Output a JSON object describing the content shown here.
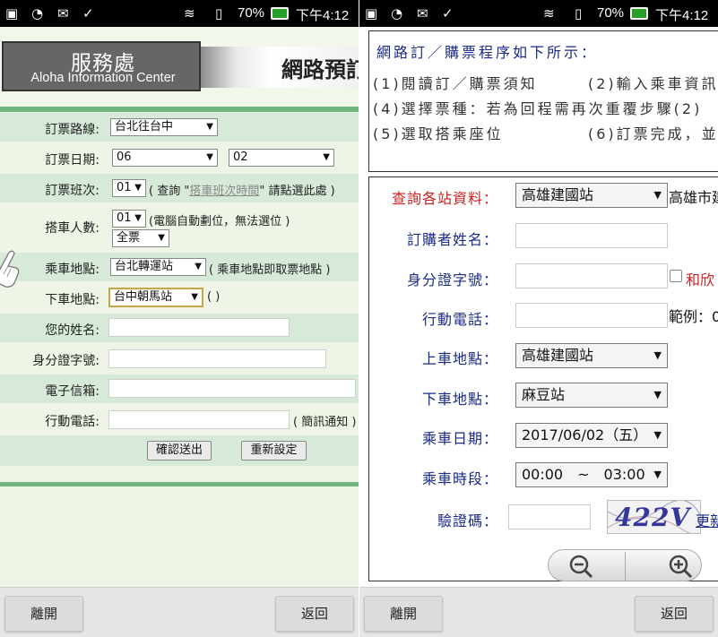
{
  "status_bar": {
    "battery": "70%",
    "time": "下午4:12"
  },
  "nav": {
    "exit_label": "離開",
    "back_label": "返回"
  },
  "left": {
    "logo": {
      "chinese": "服務處",
      "english": "Aloha Information Center"
    },
    "banner_title": "網路預訂",
    "route": {
      "label": "訂票路線:",
      "value": "台北往台中"
    },
    "date": {
      "label": "訂票日期:",
      "month": "06",
      "day": "02"
    },
    "trip": {
      "label": "訂票班次:",
      "value": "01",
      "hint_prefix": "( 查詢 \"",
      "hint_link": "搭車班次時間",
      "hint_suffix": "\" 請點選此處 )"
    },
    "passengers": {
      "label": "搭車人數:",
      "count": "01",
      "note": "(電腦自動劃位，無法選位 )",
      "ticket_type": "全票"
    },
    "boarding": {
      "label": "乘車地點:",
      "value": "台北轉運站",
      "note": "( 乘車地點即取票地點 )"
    },
    "alighting": {
      "label": "下車地點:",
      "value": "台中朝馬站",
      "note": "( )"
    },
    "name": {
      "label": "您的姓名:"
    },
    "id_number": {
      "label": "身分證字號:"
    },
    "email": {
      "label": "電子信箱:"
    },
    "mobile": {
      "label": "行動電話:",
      "note": "( 簡訊通知 )"
    },
    "confirm_label": "確認送出",
    "reset_label": "重新設定"
  },
  "right": {
    "procedure_title": "網路訂／購票程序如下所示：",
    "steps": [
      "(1)閱讀訂／購票須知",
      "(2)輸入乘車資訊",
      "(4)選擇票種：若為回程需再次重覆步驟(2)",
      "(5)選取搭乘座位",
      "(6)訂票完成，並"
    ],
    "station_query": {
      "label": "查詢各站資料：",
      "value": "高雄建國站",
      "side_text": "高雄市建"
    },
    "buyer_name": {
      "label": "訂購者姓名："
    },
    "id_number": {
      "label": "身分證字號：",
      "side_text": "和欣"
    },
    "mobile": {
      "label": "行動電話：",
      "side_text": "範例：0"
    },
    "boarding": {
      "label": "上車地點：",
      "value": "高雄建國站"
    },
    "alighting": {
      "label": "下車地點：",
      "value": "麻豆站"
    },
    "ride_date": {
      "label": "乘車日期：",
      "value": "2017/06/02（五）"
    },
    "ride_time": {
      "label": "乘車時段：",
      "value": "00:00　~　03:00"
    },
    "captcha": {
      "label": "驗證碼：",
      "image_text": "422V",
      "refresh_text": "更新"
    }
  },
  "colors": {
    "accent_green": "#6fb67c",
    "row_shade": "#d7ead9",
    "label_blue": "#1a2a8a",
    "label_red": "#cc1f1f",
    "captcha_blue": "#35379a"
  }
}
